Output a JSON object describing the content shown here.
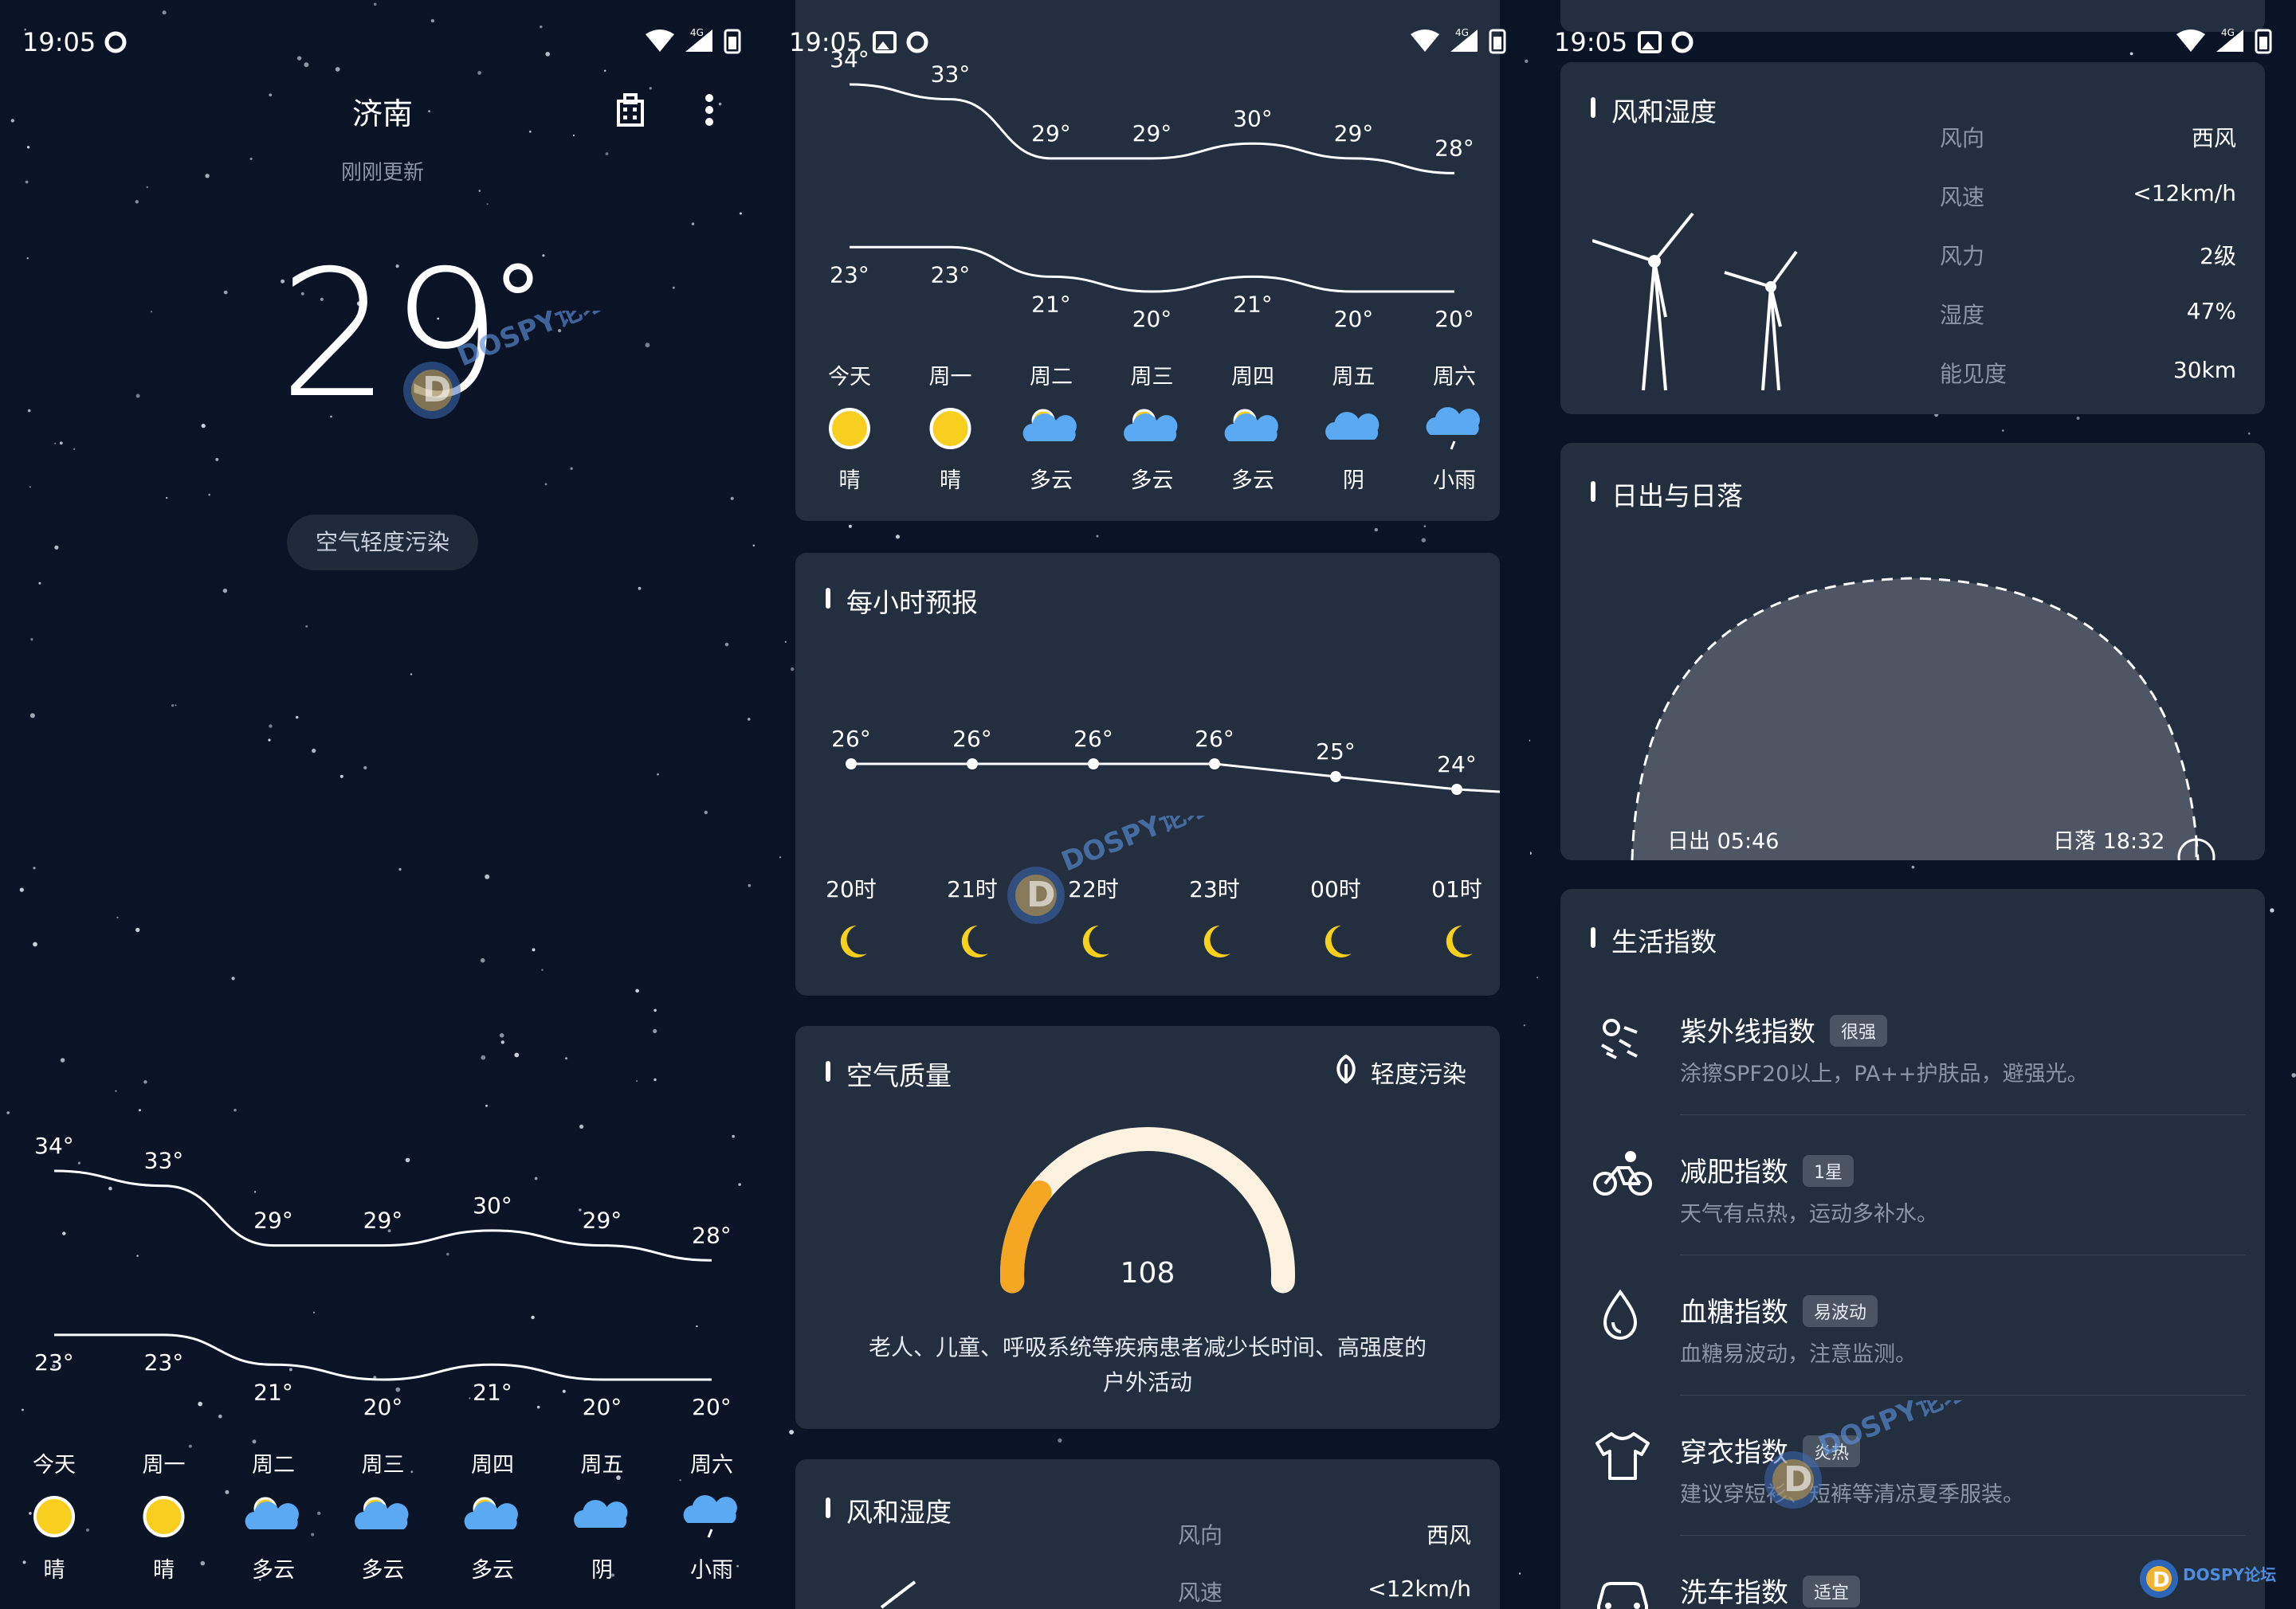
{
  "status": {
    "time": "19:05",
    "network": "4G"
  },
  "home": {
    "city": "济南",
    "updated": "刚刚更新",
    "temperature": "29",
    "degree": "°",
    "air_quality_pill": "空气轻度污染",
    "watermark": "DOSPY论坛"
  },
  "weekly": {
    "days": [
      "今天",
      "周一",
      "周二",
      "周三",
      "周四",
      "周五",
      "周六"
    ],
    "highs": [
      "34°",
      "33°",
      "29°",
      "29°",
      "30°",
      "29°",
      "28°"
    ],
    "lows": [
      "23°",
      "23°",
      "21°",
      "20°",
      "21°",
      "20°",
      "20°"
    ],
    "conditions": [
      "晴",
      "晴",
      "多云",
      "多云",
      "多云",
      "阴",
      "小雨"
    ],
    "icons": [
      "sun",
      "sun",
      "partly-cloudy",
      "partly-cloudy",
      "partly-cloudy",
      "cloudy",
      "light-rain"
    ]
  },
  "hourly": {
    "title": "每小时预报",
    "temps": [
      "26°",
      "26°",
      "26°",
      "26°",
      "25°",
      "24°"
    ],
    "times": [
      "20时",
      "21时",
      "22时",
      "23时",
      "00时",
      "01时"
    ],
    "icons": [
      "moon",
      "moon",
      "moon",
      "moon",
      "moon",
      "moon"
    ]
  },
  "aqi": {
    "title": "空气质量",
    "status": "轻度污染",
    "value": "108",
    "advice_line1": "老人、儿童、呼吸系统等疾病患者减少长时间、高强度的",
    "advice_line2": "户外活动",
    "gauge_fraction": 0.216,
    "color_fill": "#f5a623",
    "color_track": "#fdf1df"
  },
  "wind": {
    "title": "风和湿度",
    "rows": [
      {
        "label": "风向",
        "value": "西风"
      },
      {
        "label": "风速",
        "value": "<12km/h"
      },
      {
        "label": "风力",
        "value": "2级"
      },
      {
        "label": "湿度",
        "value": "47%"
      },
      {
        "label": "能见度",
        "value": "30km"
      }
    ]
  },
  "sun": {
    "title": "日出与日落",
    "sunrise": "日出 05:46",
    "sunset": "日落 18:32"
  },
  "life": {
    "title": "生活指数",
    "items": [
      {
        "icon": "uv-icon",
        "name": "紫外线指数",
        "badge": "很强",
        "desc": "涂擦SPF20以上，PA++护肤品，避强光。"
      },
      {
        "icon": "bicycle-icon",
        "name": "减肥指数",
        "badge": "1星",
        "desc": "天气有点热，运动多补水。"
      },
      {
        "icon": "drop-icon",
        "name": "血糖指数",
        "badge": "易波动",
        "desc": "血糖易波动，注意监测。"
      },
      {
        "icon": "shirt-icon",
        "name": "穿衣指数",
        "badge": "炎热",
        "desc": "建议穿短衫、短裤等清凉夏季服装。"
      },
      {
        "icon": "car-icon",
        "name": "洗车指数",
        "badge": "适宜",
        "desc": ""
      }
    ]
  },
  "colors": {
    "bg": "#0b1426",
    "card": "#232e3f",
    "sun": "#f8cf1f",
    "cloud": "#5aa9f2",
    "moon": "#f8d21a"
  }
}
